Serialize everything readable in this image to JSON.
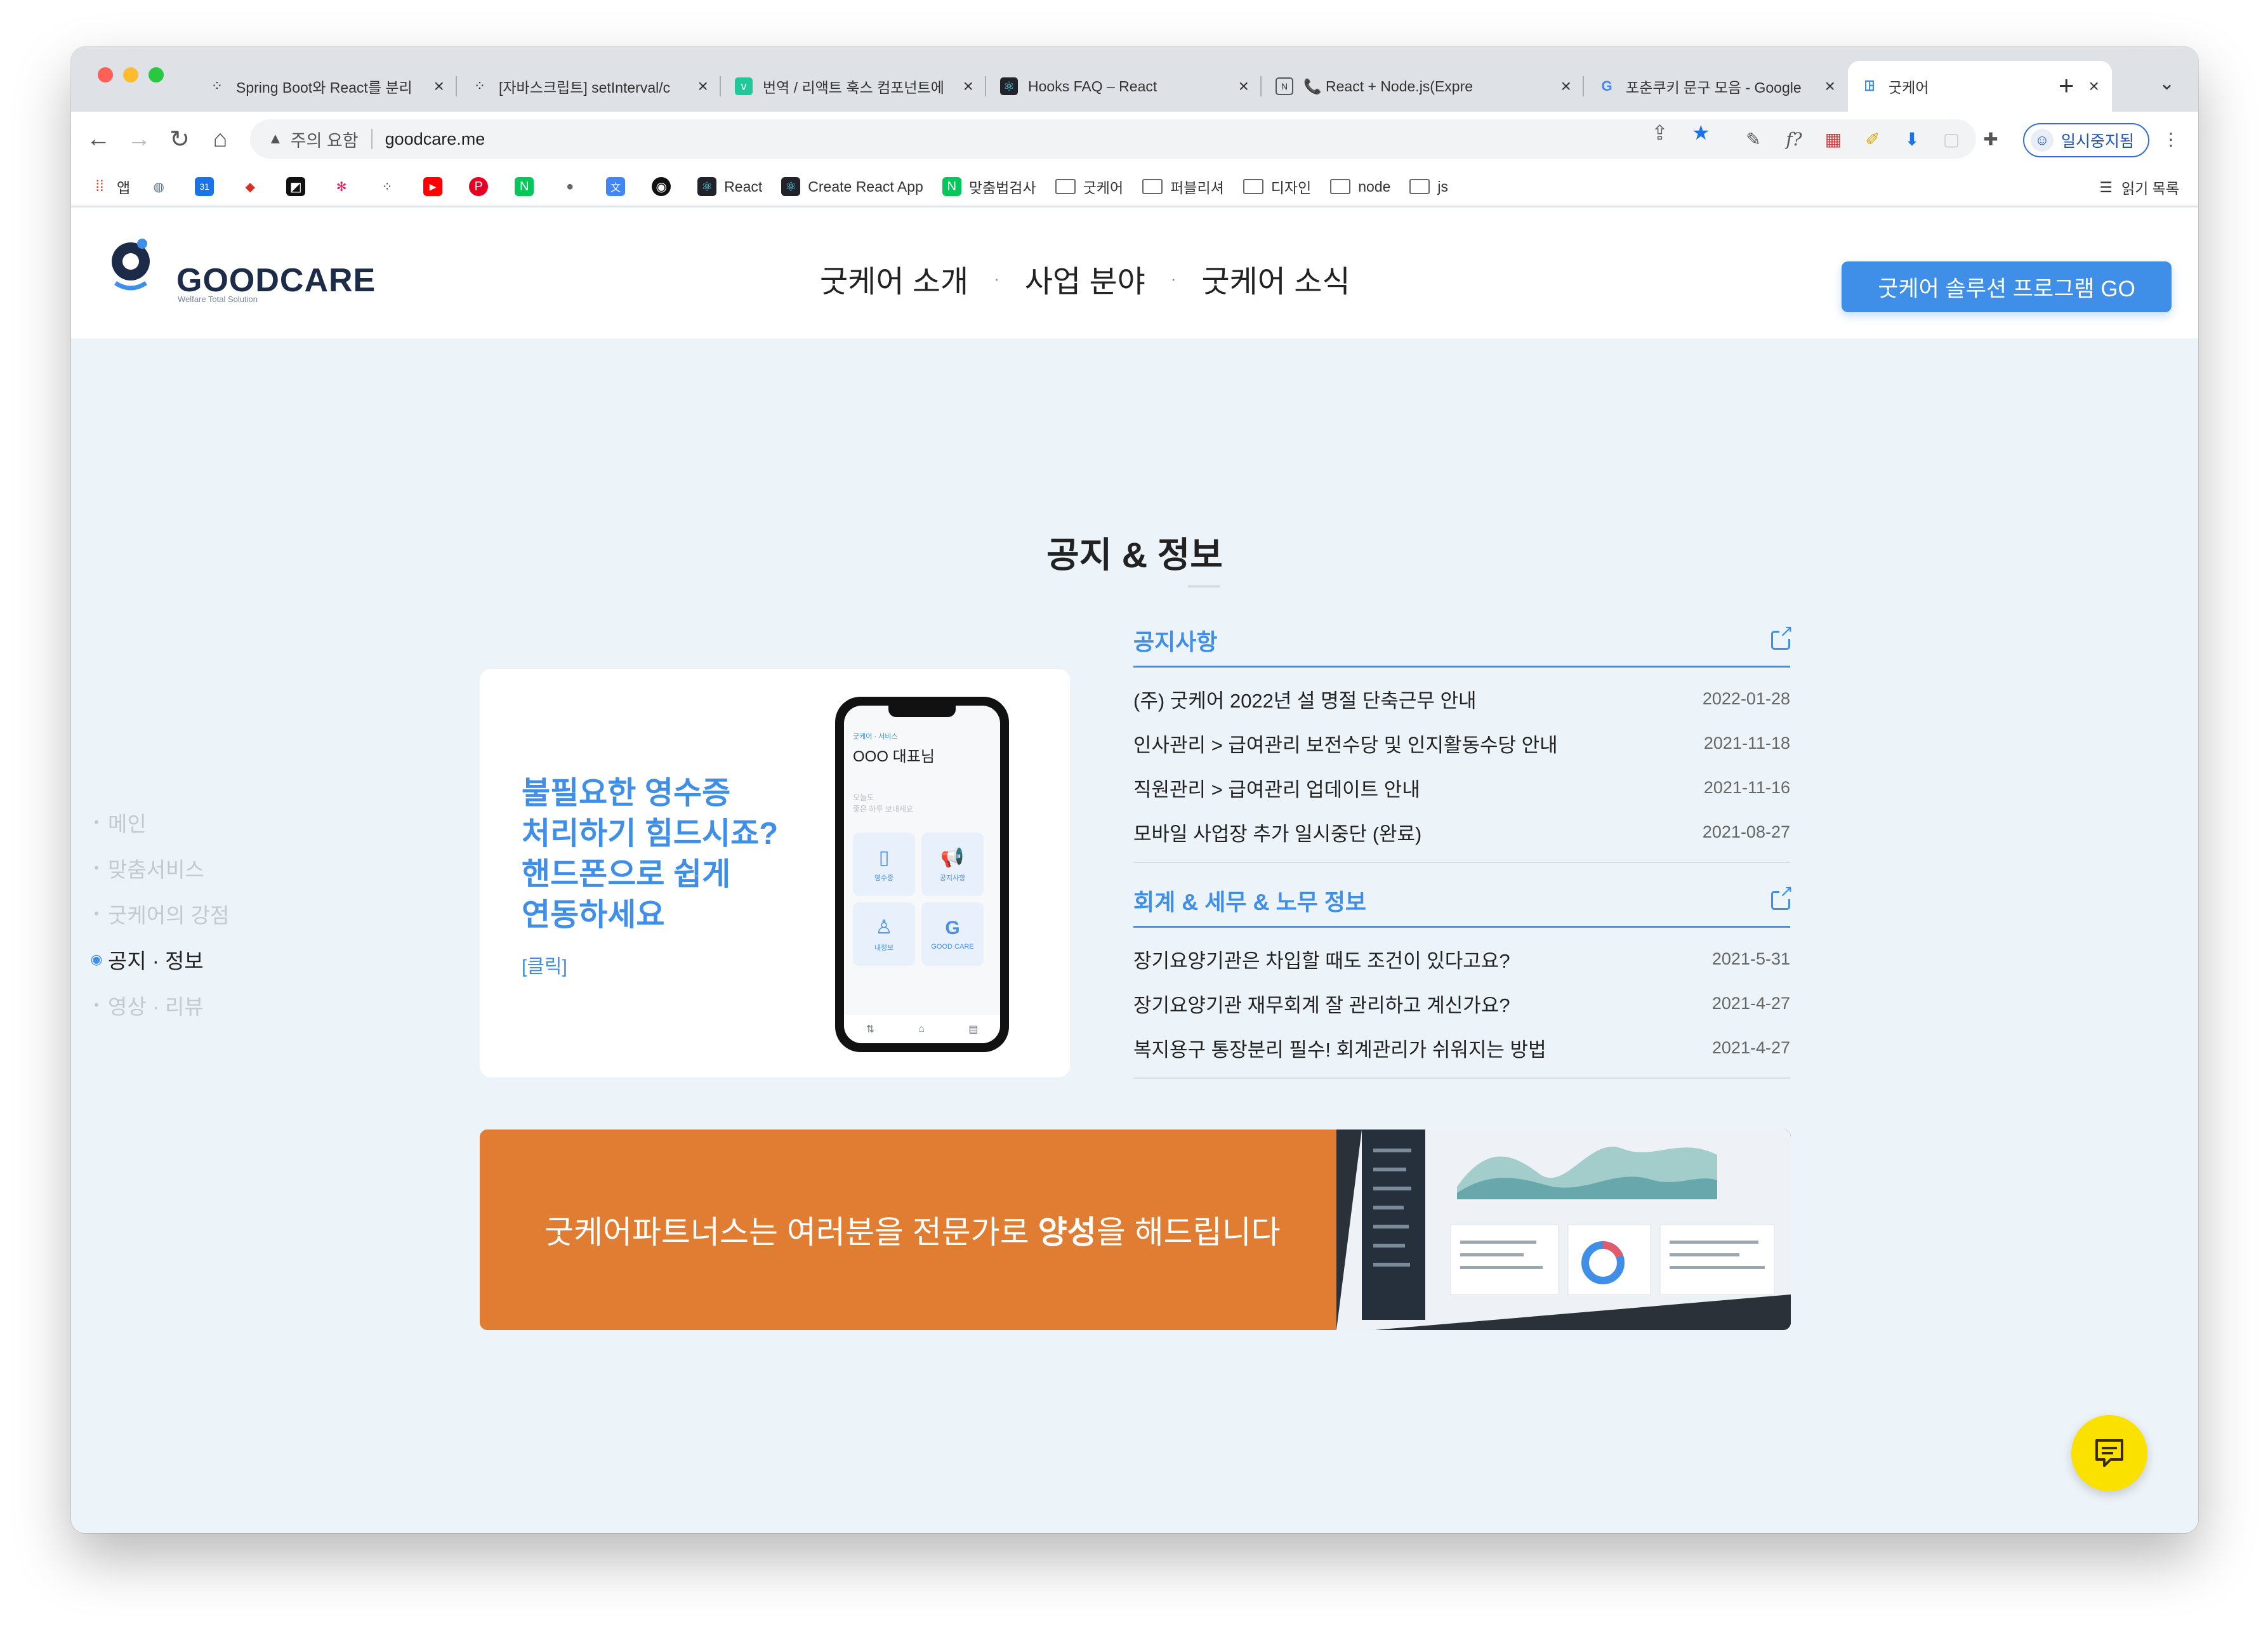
{
  "browser": {
    "tabs": [
      {
        "title": "Spring Boot와 React를 분리",
        "icon": "tistory-icon"
      },
      {
        "title": "[자바스크립트] setInterval/c",
        "icon": "tistory-icon"
      },
      {
        "title": "번역 / 리액트 훅스 컴포넌트에",
        "icon": "velog-icon"
      },
      {
        "title": "Hooks FAQ – React",
        "icon": "react-icon"
      },
      {
        "title": "📞 React + Node.js(Expre",
        "icon": "notion-icon"
      },
      {
        "title": "포춘쿠키 문구 모음 - Google",
        "icon": "google-icon"
      },
      {
        "title": "굿케어",
        "icon": "goodcare-icon",
        "active": true
      }
    ],
    "new_tab_label": "+",
    "address": {
      "warning": "주의 요함",
      "url": "goodcare.me"
    },
    "profile_label": "일시중지됨",
    "bookmarks": [
      {
        "label": "앱",
        "icon": "apps-icon"
      },
      {
        "label": "",
        "icon": "site-icon-1"
      },
      {
        "label": "",
        "icon": "calendar-icon"
      },
      {
        "label": "",
        "icon": "site-icon-2"
      },
      {
        "label": "",
        "icon": "site-icon-3"
      },
      {
        "label": "",
        "icon": "slack-icon"
      },
      {
        "label": "",
        "icon": "tistory-icon"
      },
      {
        "label": "",
        "icon": "youtube-icon"
      },
      {
        "label": "",
        "icon": "pinterest-icon"
      },
      {
        "label": "",
        "icon": "naver-icon"
      },
      {
        "label": "",
        "icon": "apple-icon"
      },
      {
        "label": "",
        "icon": "translate-icon"
      },
      {
        "label": "",
        "icon": "github-icon"
      },
      {
        "label": "React",
        "icon": "react-icon"
      },
      {
        "label": "Create React App",
        "icon": "cra-icon"
      },
      {
        "label": "맞춤법검사",
        "icon": "naver-icon"
      },
      {
        "label": "굿케어",
        "icon": "folder-icon"
      },
      {
        "label": "퍼블리셔",
        "icon": "folder-icon"
      },
      {
        "label": "디자인",
        "icon": "folder-icon"
      },
      {
        "label": "node",
        "icon": "folder-icon"
      },
      {
        "label": "js",
        "icon": "folder-icon"
      }
    ],
    "reading_list_label": "읽기 목록"
  },
  "site": {
    "logo_text": "GOODCARE",
    "logo_sub": "Welfare Total Solution",
    "nav": [
      "굿케어 소개",
      "사업 분야",
      "굿케어 소식"
    ],
    "cta_label": "굿케어 솔루션 프로그램 GO",
    "side_nav": [
      {
        "label": "메인",
        "active": false
      },
      {
        "label": "맞춤서비스",
        "active": false
      },
      {
        "label": "굿케어의 강점",
        "active": false
      },
      {
        "label": "공지 · 정보",
        "active": true
      },
      {
        "label": "영상 · 리뷰",
        "active": false
      }
    ],
    "section_title": "공지 & 정보",
    "promo": {
      "lines": [
        "불필요한 영수증",
        "처리하기 힘드시죠?",
        "핸드폰으로 쉽게",
        "연동하세요"
      ],
      "click_label": "[클릭]",
      "phone": {
        "top": "굿케어 · 서비스",
        "name": "OOO 대표님",
        "greet": [
          "오늘도",
          "좋은 하루 보내세요"
        ],
        "tiles": [
          "영수증",
          "공지사항",
          "내정보",
          "GOOD CARE"
        ]
      }
    },
    "notice": {
      "title": "공지사항",
      "items": [
        {
          "title": "(주) 굿케어 2022년 설 명절 단축근무 안내",
          "date": "2022-01-28"
        },
        {
          "title": "인사관리 > 급여관리 보전수당 및 인지활동수당 안내",
          "date": "2021-11-18"
        },
        {
          "title": "직원관리 > 급여관리 업데이트 안내",
          "date": "2021-11-16"
        },
        {
          "title": "모바일 사업장 추가 일시중단 (완료)",
          "date": "2021-08-27"
        }
      ]
    },
    "info": {
      "title": "회계 & 세무 & 노무 정보",
      "items": [
        {
          "title": "장기요양기관은 차입할 때도 조건이 있다고요?",
          "date": "2021-5-31"
        },
        {
          "title": "장기요양기관 재무회계 잘 관리하고 계신가요?",
          "date": "2021-4-27"
        },
        {
          "title": "복지용구 통장분리 필수! 회계관리가 쉬워지는 방법",
          "date": "2021-4-27"
        }
      ]
    },
    "banner": {
      "text_before": "굿케어파트너스는 여러분을 전문가로 ",
      "text_bold": "양성",
      "text_after": "을 해드립니다"
    },
    "accent_color": "#3f8ee8",
    "banner_color": "#e07d32",
    "chat_color": "#fae100"
  }
}
